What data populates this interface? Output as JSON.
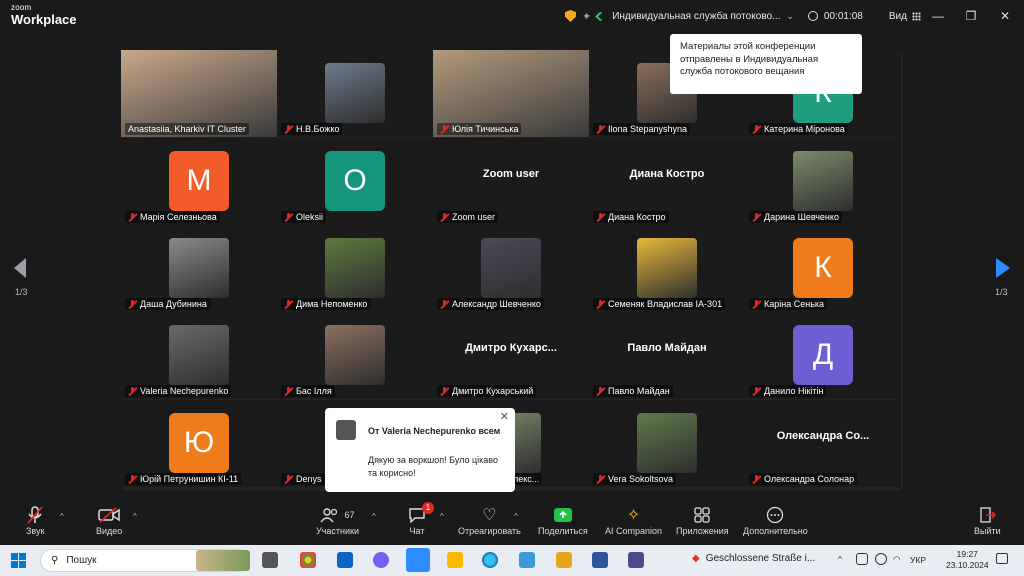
{
  "app": {
    "logo_line1": "zoom",
    "logo_line2": "Workplace"
  },
  "titlebar": {
    "stream_title": "Индивидуальная служба потоково...",
    "timer": "00:01:08",
    "view_label": "Вид"
  },
  "tooltip": {
    "text": "Материалы этой конференции отправлены в Индивидуальная служба потокового вещания"
  },
  "gallery": {
    "page_indicator_left": "1/3",
    "page_indicator_right": "1/3",
    "tiles": [
      {
        "name": "Anastasiia, Kharkiv IT Cluster",
        "type": "photo",
        "color": "#c9a88b",
        "active": true
      },
      {
        "name": "Н.В.Божко",
        "type": "photo",
        "color": "#6d7a8c"
      },
      {
        "name": "Юлія Тичинська",
        "type": "photo",
        "color": "#b29a7c"
      },
      {
        "name": "Ilona Stepanyshyna",
        "type": "photo",
        "color": "#8a6e5a"
      },
      {
        "name": "Катерина Міронова",
        "type": "letter",
        "letter": "К",
        "color": "#1f9d7d"
      },
      {
        "name": "Марія Селезньова",
        "type": "letter",
        "letter": "М",
        "color": "#f25b2a"
      },
      {
        "name": "Oleksii",
        "type": "letter",
        "letter": "O",
        "color": "#15957c"
      },
      {
        "name": "Zoom user",
        "type": "text",
        "big": "Zoom user"
      },
      {
        "name": "Диана Костро",
        "type": "text",
        "big": "Диана Костро"
      },
      {
        "name": "Дарина Шевченко",
        "type": "photo",
        "color": "#7c8a6a"
      },
      {
        "name": "Даша Дубинина",
        "type": "photo",
        "color": "#8a8a8a"
      },
      {
        "name": "Дима Непоменко",
        "type": "photo",
        "color": "#5c7a3e"
      },
      {
        "name": "Александр Шевченко",
        "type": "photo",
        "color": "#4a4a5a"
      },
      {
        "name": "Семеняк Владислав ІА-301",
        "type": "photo",
        "color": "#e8b83a"
      },
      {
        "name": "Каріна Сенька",
        "type": "letter",
        "letter": "К",
        "color": "#f07b1a"
      },
      {
        "name": "Valeria Nechepurenko",
        "type": "photo",
        "color": "#6a6a6a"
      },
      {
        "name": "Бас Ілля",
        "type": "photo",
        "color": "#8c7060"
      },
      {
        "name": "Дмитро Кухарський",
        "type": "text",
        "big": "Дмитро  Кухарс..."
      },
      {
        "name": "Павло Майдан",
        "type": "text",
        "big": "Павло Майдан"
      },
      {
        "name": "Данило Нікітін",
        "type": "letter",
        "letter": "Д",
        "color": "#6b5fd3"
      },
      {
        "name": "Юрій Петрунишин КІ-11",
        "type": "letter",
        "letter": "Ю",
        "color": "#f07b1a"
      },
      {
        "name": "Denys",
        "type": "photo",
        "color": "#555"
      },
      {
        "name": "Максиміліан Олекс...",
        "type": "photo",
        "color": "#7a8a6a"
      },
      {
        "name": "Vera Sokoltsova",
        "type": "photo",
        "color": "#5f7a4a"
      },
      {
        "name": "Олександра Солонар",
        "type": "text",
        "big": "Олександра  Со..."
      }
    ]
  },
  "chat_popup": {
    "from": "От Valeria Nechepurenko всем",
    "message": "Дякую за воркшоп! Було цікаво та корисно!"
  },
  "toolbar": {
    "audio": "Звук",
    "video": "Видео",
    "participants": "Участники",
    "participants_count": "67",
    "chat": "Чат",
    "chat_badge": "1",
    "react": "Отреагировать",
    "share": "Поделиться",
    "ai": "AI Companion",
    "apps": "Приложения",
    "more": "Дополнительно",
    "leave": "Выйти"
  },
  "taskbar": {
    "search_placeholder": "Пошук",
    "notification": "Geschlossene Straße i...",
    "lang": "УКР",
    "time": "19:27",
    "date": "23.10.2024"
  }
}
